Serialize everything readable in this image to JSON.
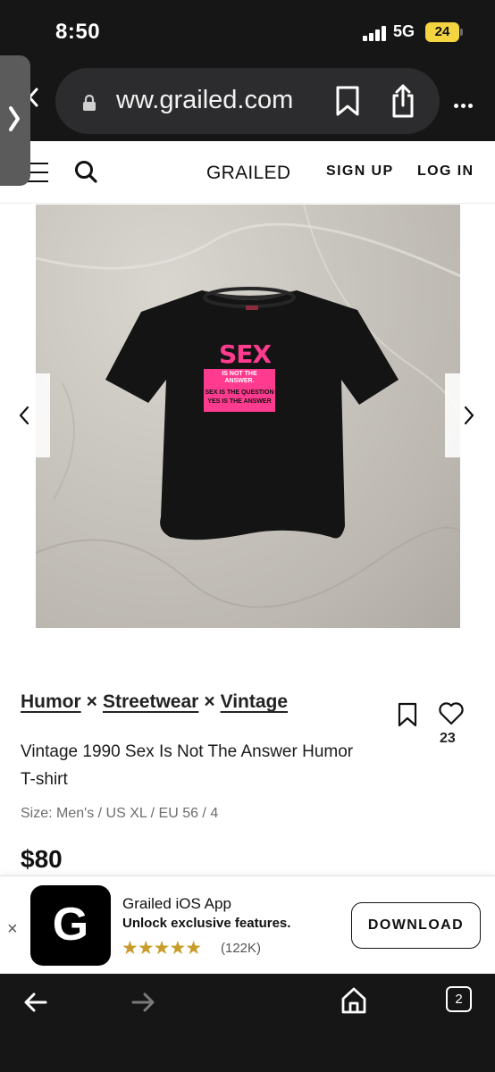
{
  "status_bar": {
    "time": "8:50",
    "network": "5G",
    "battery": "24"
  },
  "browser": {
    "url": "ww.grailed.com"
  },
  "header": {
    "brand": "GRAILED",
    "sign_up": "SIGN UP",
    "log_in": "LOG IN"
  },
  "product": {
    "designers": [
      "Humor",
      "Streetwear",
      "Vintage"
    ],
    "separator": "×",
    "title": "Vintage 1990 Sex Is Not The Answer Humor T-shirt",
    "size": "Size: Men's / US XL / EU 56 / 4",
    "price": "$80",
    "likes": "23",
    "shirt_print": {
      "headline": "SEX",
      "line1": "IS NOT THE",
      "line2": "ANSWER.",
      "line3": "SEX IS THE QUESTION",
      "line4": "YES IS THE ANSWER"
    }
  },
  "app_banner": {
    "close": "×",
    "logo_letter": "G",
    "name": "Grailed iOS App",
    "tagline": "Unlock exclusive features.",
    "stars": "★★★★★",
    "reviews": "(122K)",
    "download": "DOWNLOAD"
  },
  "toolbar": {
    "tabs_count": "2"
  },
  "colors": {
    "chrome_bg": "#161616",
    "battery": "#f5d442",
    "print_pink": "#ff3b8f",
    "star": "#c89b2a"
  },
  "icons": [
    "lock-icon",
    "bookmark-icon",
    "share-icon",
    "more-icon",
    "menu-icon",
    "search-icon",
    "chevron-left-icon",
    "chevron-right-icon",
    "heart-icon",
    "back-arrow-icon",
    "forward-arrow-icon",
    "home-icon",
    "tabs-icon"
  ]
}
